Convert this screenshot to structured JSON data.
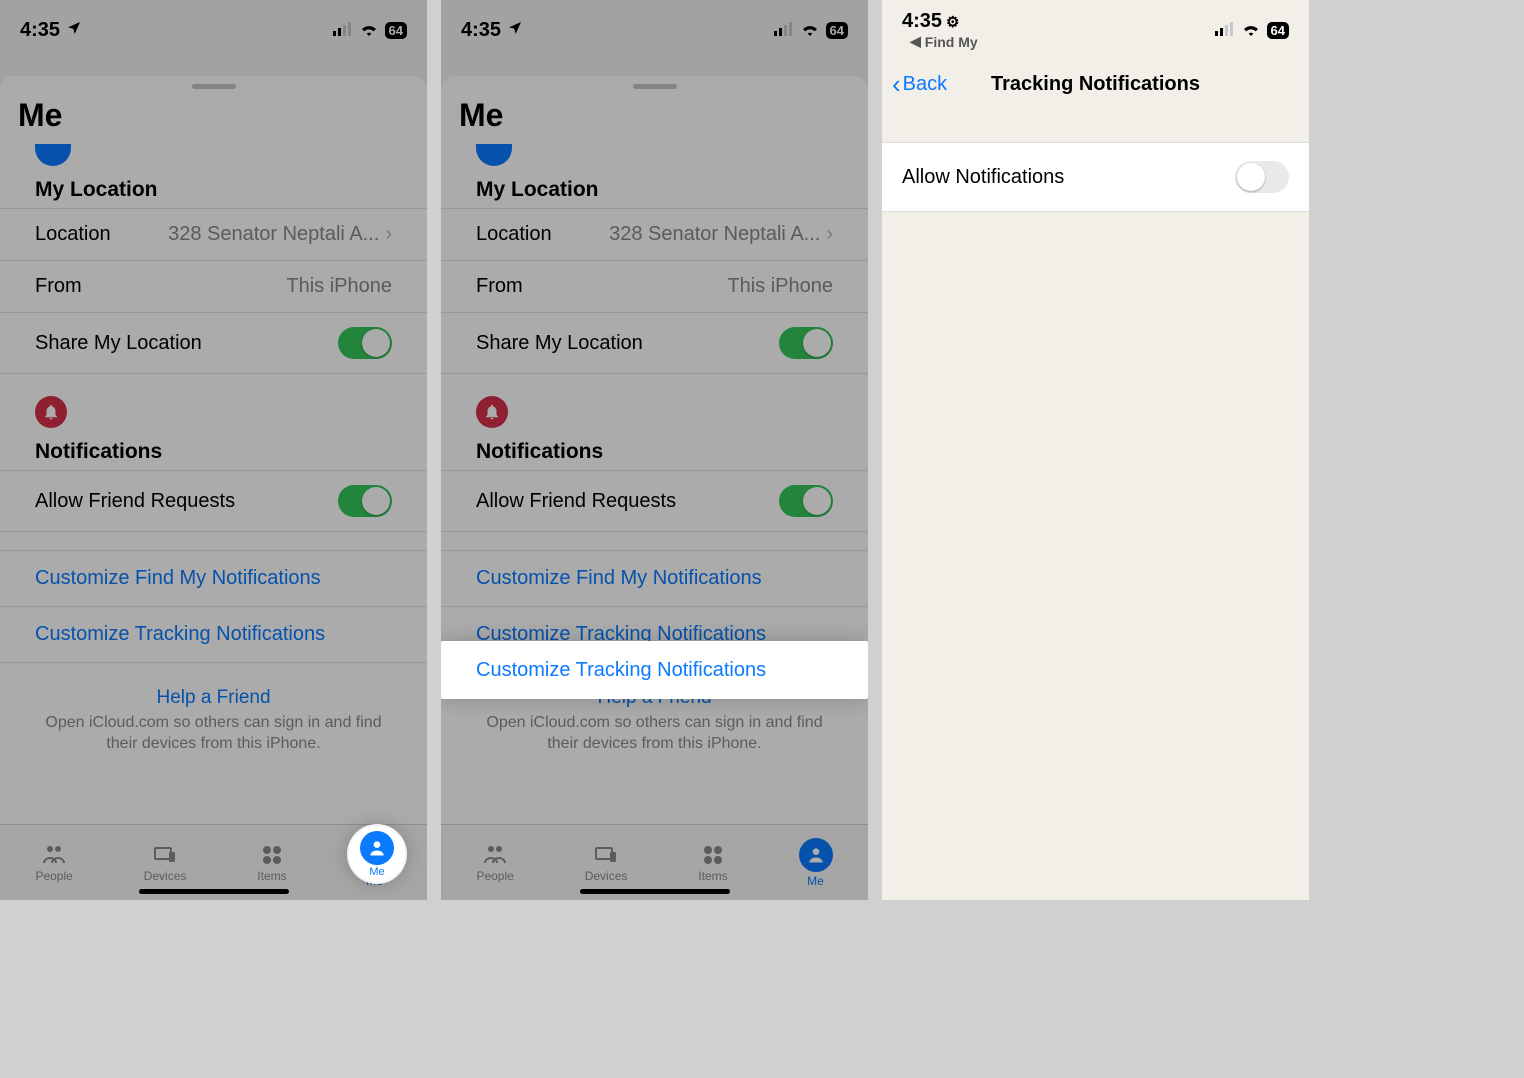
{
  "status": {
    "time": "4:35",
    "battery": "64",
    "back_app": "Find My"
  },
  "me_sheet": {
    "title": "Me",
    "section_location": "My Location",
    "row_location_label": "Location",
    "row_location_value": "328 Senator Neptali A...",
    "row_from_label": "From",
    "row_from_value": "This iPhone",
    "row_share_label": "Share My Location",
    "section_notifications": "Notifications",
    "row_friend_requests": "Allow Friend Requests",
    "link_customize_findmy": "Customize Find My Notifications",
    "link_customize_tracking": "Customize Tracking Notifications",
    "help_title": "Help a Friend",
    "help_desc": "Open iCloud.com so others can sign in and find their devices from this iPhone."
  },
  "tabs": {
    "people": "People",
    "devices": "Devices",
    "items": "Items",
    "me": "Me"
  },
  "screen3": {
    "nav_back": "Back",
    "nav_title": "Tracking Notifications",
    "row_allow": "Allow Notifications"
  }
}
